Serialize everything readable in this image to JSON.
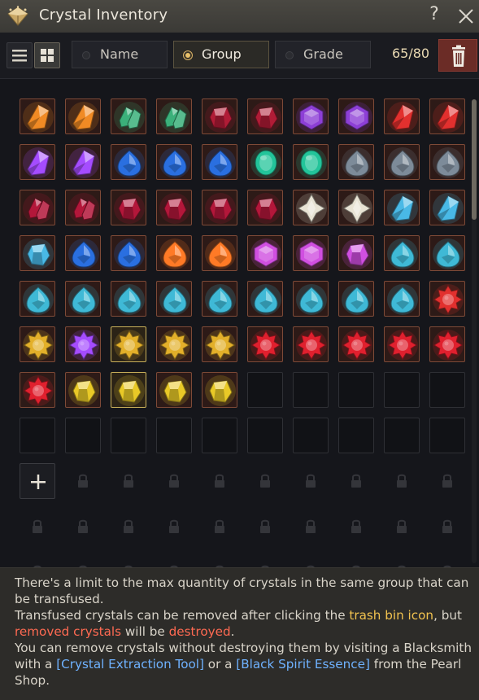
{
  "window": {
    "title": "Crystal Inventory",
    "help_label": "?",
    "logo_icon": "diamond-crest-icon",
    "close_icon": "close-icon"
  },
  "toolbar": {
    "view_list_icon": "list-view-icon",
    "view_grid_icon": "grid-view-icon",
    "active_view": "grid",
    "sort_options": [
      {
        "label": "Name",
        "selected": false
      },
      {
        "label": "Group",
        "selected": true
      },
      {
        "label": "Grade",
        "selected": false
      }
    ],
    "count": "65/80",
    "trash_icon": "trash-icon"
  },
  "colors": {
    "orange": "#f08a24",
    "green": "#3bb07a",
    "darkred": "#b01c36",
    "purple": "#8d3fd6",
    "red": "#e2302e",
    "violet": "#a54cff",
    "blue": "#2a6fe0",
    "teal": "#23c49a",
    "gray": "#7d8b99",
    "crimson": "#b3173a",
    "white": "#e8e3d4",
    "cyan": "#49b9e6",
    "cyan2": "#3fb9d6",
    "amber": "#ff7a26",
    "magenta": "#d04fe0",
    "gold": "#e3b02a",
    "sunred": "#e0202e",
    "yellow": "#e9c927"
  },
  "crystals": [
    [
      "orange",
      "orange",
      "green",
      "green",
      "darkred",
      "darkred",
      "purple",
      "purple",
      "red",
      "red"
    ],
    [
      "violet",
      "violet",
      "blue",
      "blue",
      "blue",
      "teal",
      "teal",
      "gray",
      "gray",
      "gray"
    ],
    [
      "crimson",
      "crimson",
      "crimson",
      "crimson",
      "crimson",
      "crimson",
      "white",
      "white",
      "cyan",
      "cyan"
    ],
    [
      "cyan",
      "blue",
      "blue",
      "amber",
      "amber",
      "magenta",
      "magenta",
      "magenta",
      "cyan2",
      "cyan2"
    ],
    [
      "cyan2",
      "cyan2",
      "cyan2",
      "cyan2",
      "cyan2",
      "cyan2",
      "cyan2",
      "cyan2",
      "cyan2",
      "red"
    ],
    [
      "gold",
      "violet",
      "gold",
      "gold",
      "gold",
      "sunred",
      "sunred",
      "sunred",
      "sunred",
      "sunred"
    ],
    [
      "sunred",
      "yellow",
      "yellow",
      "yellow",
      "yellow"
    ]
  ],
  "crystal_shapes": [
    [
      "shard",
      "shard",
      "cluster",
      "cluster",
      "gem",
      "gem",
      "hex",
      "hex",
      "shard",
      "shard"
    ],
    [
      "shard",
      "shard",
      "drop",
      "drop",
      "drop",
      "oval",
      "oval",
      "drop",
      "drop",
      "drop"
    ],
    [
      "cluster",
      "cluster",
      "gem",
      "gem",
      "gem",
      "gem",
      "star",
      "star",
      "shard",
      "shard"
    ],
    [
      "gem",
      "drop",
      "drop",
      "drop",
      "drop",
      "hex",
      "hex",
      "gem",
      "drop",
      "drop"
    ],
    [
      "drop",
      "drop",
      "drop",
      "drop",
      "drop",
      "drop",
      "drop",
      "drop",
      "drop",
      "sun"
    ],
    [
      "sun",
      "sun",
      "sun",
      "sun",
      "sun",
      "sun",
      "sun",
      "sun",
      "sun",
      "sun"
    ],
    [
      "sun",
      "gem",
      "gem",
      "gem",
      "gem"
    ]
  ],
  "highlighted_slots": [
    "r5c2",
    "r6c2"
  ],
  "slots": {
    "empty_count": 15,
    "add_icon": "plus-icon",
    "locked_icon": "lock-icon"
  },
  "info": {
    "line1": "There's a limit to the max quantity of crystals in the same group that can be transfused.",
    "line2_a": "Transfused crystals can be removed after clicking the ",
    "line2_b": "trash bin icon",
    "line2_c": ", but ",
    "line2_d": "removed crystals",
    "line2_e": " will be ",
    "line2_f": "destroyed",
    "line2_g": ".",
    "line3_a": "You can remove crystals without destroying them by visiting a Blacksmith with a ",
    "line3_b": "[Crystal Extraction Tool]",
    "line3_c": " or a ",
    "line3_d": "[Black Spirit Essence]",
    "line3_e": " from the Pearl Shop."
  }
}
